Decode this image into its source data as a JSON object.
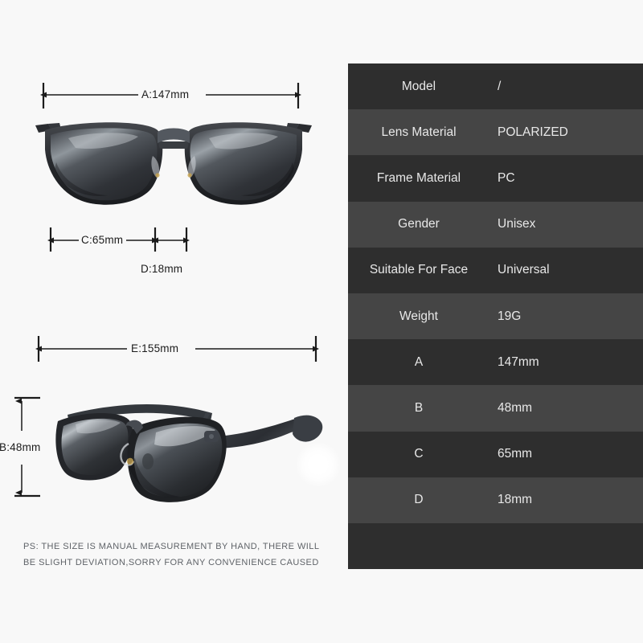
{
  "product": {
    "front_view_alt": "sunglasses-front-view",
    "angled_view_alt": "sunglasses-angled-view"
  },
  "dimensions": {
    "a_label": "A:147mm",
    "c_label": "C:65mm",
    "d_label": "D:18mm",
    "e_label": "E:155mm",
    "b_label": "B:48mm"
  },
  "disclaimer": {
    "line1": "PS: THE SIZE IS MANUAL MEASUREMENT BY HAND, THERE WILL",
    "line2": "BE SLIGHT DEVIATION,SORRY FOR ANY CONVENIENCE CAUSED"
  },
  "spec_table": {
    "rows": [
      {
        "key": "Model",
        "value": "/"
      },
      {
        "key": "Lens Material",
        "value": "POLARIZED"
      },
      {
        "key": "Frame Material",
        "value": "PC"
      },
      {
        "key": "Gender",
        "value": "Unisex"
      },
      {
        "key": "Suitable For Face",
        "value": "Universal"
      },
      {
        "key": "Weight",
        "value": "19G"
      },
      {
        "key": "A",
        "value": "147mm"
      },
      {
        "key": "B",
        "value": "48mm"
      },
      {
        "key": "C",
        "value": "65mm"
      },
      {
        "key": "D",
        "value": "18mm"
      },
      {
        "key": "",
        "value": ""
      }
    ]
  },
  "colors": {
    "background": "#f8f8f8",
    "row_dark": "#2e2e2e",
    "row_light": "#454545",
    "text_light": "#e8e8e8",
    "dimension_line": "#1b1b1b",
    "disclaimer_text": "#5f6368"
  }
}
